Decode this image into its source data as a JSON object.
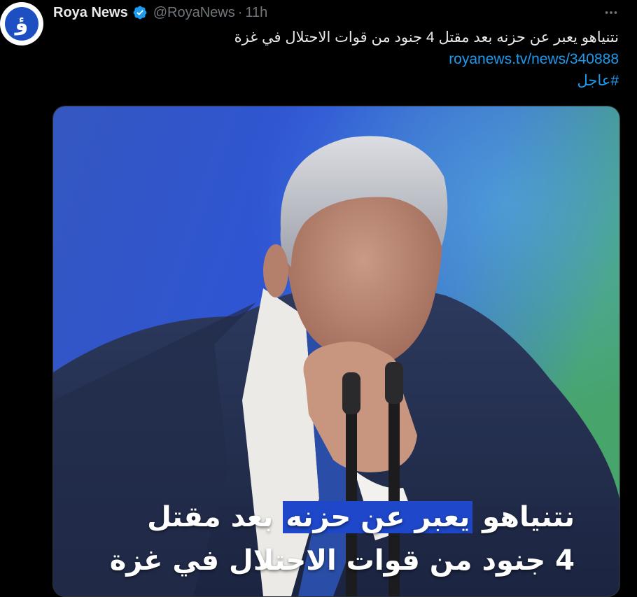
{
  "tweet": {
    "avatar_glyph": "ؤ",
    "author_name": "Roya News",
    "handle": "@RoyaNews",
    "separator": "·",
    "time": "11h",
    "verified_icon": "verified-badge-icon",
    "more_icon": "more-horizontal-icon",
    "text": "نتنياهو يعبر عن حزنه بعد مقتل 4 جنود من قوات الاحتلال في غزة",
    "link": "royanews.tv/news/340888",
    "hashtag": "#عاجل"
  },
  "media": {
    "caption_line1_pre": "نتنياهو",
    "caption_line1_highlight": "يعبر عن حزنه",
    "caption_line1_post": "بعد مقتل",
    "caption_line2": "4 جنود من قوات الاحتلال في غزة"
  },
  "colors": {
    "background": "#000000",
    "link": "#1d9bf0",
    "verified": "#1d9bf0",
    "muted": "#71767b",
    "caption_highlight": "#1e47c9",
    "brand": "#1d4fc2"
  }
}
